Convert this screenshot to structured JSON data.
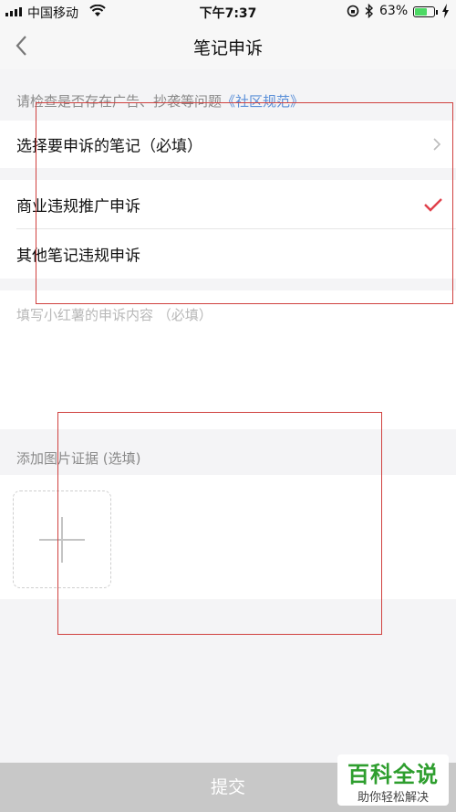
{
  "status_bar": {
    "carrier": "中国移动",
    "time": "下午7:37",
    "battery_percent": "63%",
    "battery_level": 0.63,
    "icons": [
      "signal-icon",
      "wifi-icon",
      "rotation-lock-icon",
      "bluetooth-icon",
      "battery-icon",
      "charging-icon"
    ]
  },
  "nav": {
    "title": "笔记申诉",
    "back_icon": "chevron-left-icon"
  },
  "hint": {
    "text": "请检查是否存在广告、抄袭等问题",
    "link": "《社区规范》"
  },
  "select_note": {
    "label": "选择要申诉的笔记（必填）",
    "icon": "chevron-right-icon"
  },
  "complaint_types": [
    {
      "label": "商业违规推广申诉",
      "selected": true
    },
    {
      "label": "其他笔记违规申诉",
      "selected": false
    }
  ],
  "content": {
    "placeholder": "填写小红薯的申诉内容 （必填）"
  },
  "evidence": {
    "label": "添加图片证据 (选填)",
    "add_icon": "plus-icon"
  },
  "submit": {
    "label": "提交"
  },
  "colors": {
    "accent_check": "#e0404a",
    "link": "#5a8fd8",
    "submit_bg": "#c8c8c8",
    "annotation": "#d0413f"
  },
  "watermark": {
    "main": "百科全说",
    "sub": "助你轻松解决"
  }
}
